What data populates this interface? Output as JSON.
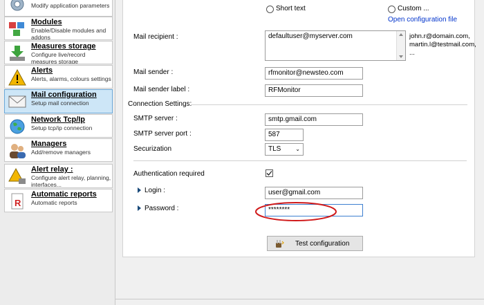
{
  "sidebar": {
    "items": [
      {
        "title": "",
        "desc": "Modify application parameters"
      },
      {
        "title": "Modules",
        "desc": "Enable/Disable modules and addons"
      },
      {
        "title": "Measures storage",
        "desc": "Configure live/record measures storage"
      },
      {
        "title": "Alerts",
        "desc": "Alerts, alarms, colours settings"
      },
      {
        "title": "Mail configuration",
        "desc": "Setup mail connection"
      },
      {
        "title": "Network Tcp/Ip",
        "desc": "Setup tcp/ip connection"
      },
      {
        "title": "Managers",
        "desc": "Add/remove managers"
      },
      {
        "title": "Alert relay :",
        "desc": "Configure alert relay, planning, interfaces..."
      },
      {
        "title": "Automatic reports",
        "desc": "Automatic reports"
      }
    ]
  },
  "format": {
    "short_text_label": "Short text",
    "custom_label": "Custom ...",
    "open_config_link": "Open configuration file"
  },
  "mail": {
    "recipient_label": "Mail recipient :",
    "recipient_value": "defaultuser@myserver.com",
    "recipient_hint": [
      "john.r@domain.com,",
      "martin.l@testmail.com,",
      "..."
    ],
    "sender_label": "Mail sender :",
    "sender_value": "rfmonitor@newsteo.com",
    "sender_label_label": "Mail sender label :",
    "sender_label_value": "RFMonitor"
  },
  "connection": {
    "section_label": "Connection Settings:",
    "smtp_server_label": "SMTP server :",
    "smtp_server_value": "smtp.gmail.com",
    "smtp_port_label": "SMTP server port :",
    "smtp_port_value": "587",
    "securization_label": "Securization",
    "securization_value": "TLS",
    "auth_label": "Authentication required",
    "auth_checked": true,
    "login_label": "Login :",
    "login_value": "user@gmail.com",
    "password_label": "Password :",
    "password_value": "********",
    "test_button_label": "Test configuration"
  },
  "colors": {
    "active_nav_bg": "#cde6f7",
    "link": "#0033cc",
    "annotation_circle": "#d0191a"
  }
}
